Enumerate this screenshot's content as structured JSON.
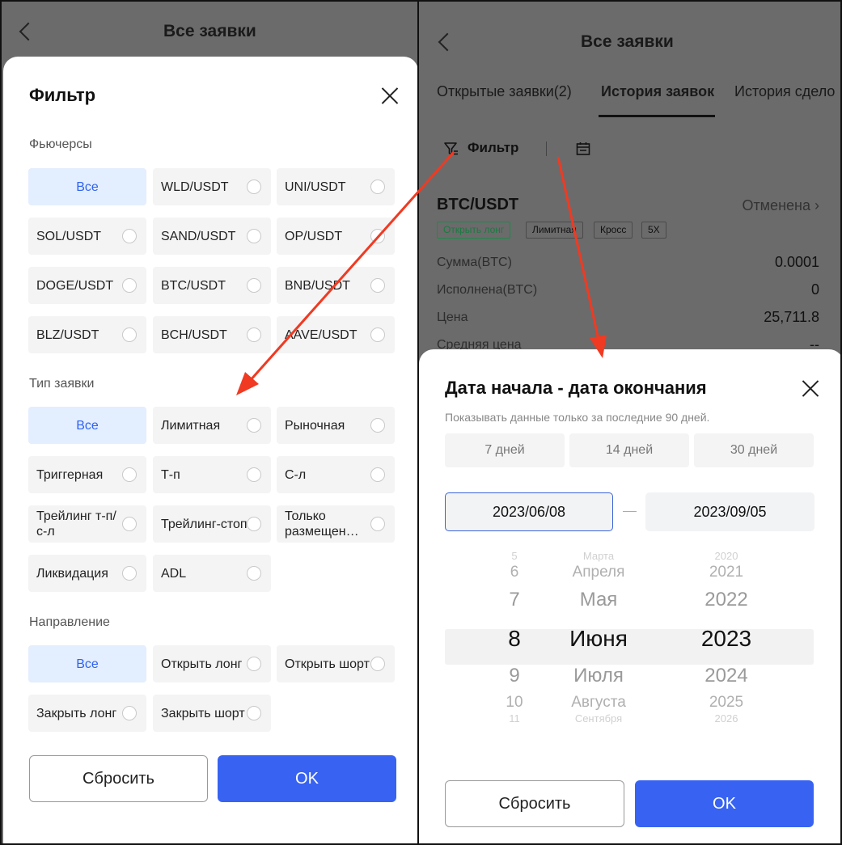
{
  "left": {
    "header": {
      "title": "Все заявки"
    },
    "filter": {
      "title": "Фильтр",
      "sections": [
        {
          "title": "Фьючерсы",
          "chips": [
            {
              "label": "Все",
              "selected": true
            },
            {
              "label": "WLD/USDT"
            },
            {
              "label": "UNI/USDT"
            },
            {
              "label": "SOL/USDT"
            },
            {
              "label": "SAND/USDT"
            },
            {
              "label": "OP/USDT"
            },
            {
              "label": "DOGE/USDT"
            },
            {
              "label": "BTC/USDT"
            },
            {
              "label": "BNB/USDT"
            },
            {
              "label": "BLZ/USDT"
            },
            {
              "label": "BCH/USDT"
            },
            {
              "label": "AAVE/USDT"
            }
          ]
        },
        {
          "title": "Тип заявки",
          "chips": [
            {
              "label": "Все",
              "selected": true
            },
            {
              "label": "Лимитная"
            },
            {
              "label": "Рыночная"
            },
            {
              "label": "Триггерная"
            },
            {
              "label": "Т-п"
            },
            {
              "label": "С-л"
            },
            {
              "label": "Трейлинг т-п/с-л"
            },
            {
              "label": "Трейлинг-стоп"
            },
            {
              "label": "Только размещен…"
            },
            {
              "label": "Ликвидация"
            },
            {
              "label": "ADL"
            }
          ]
        },
        {
          "title": "Направление",
          "chips": [
            {
              "label": "Все",
              "selected": true
            },
            {
              "label": "Открыть лонг"
            },
            {
              "label": "Открыть шорт"
            },
            {
              "label": "Закрыть лонг"
            },
            {
              "label": "Закрыть шорт"
            }
          ]
        }
      ],
      "reset_label": "Сбросить",
      "ok_label": "OK"
    }
  },
  "right": {
    "header": {
      "title": "Все заявки"
    },
    "tabs": [
      {
        "label": "Открытые заявки(2)",
        "active": false
      },
      {
        "label": "История заявок",
        "active": true
      },
      {
        "label": "История сдело",
        "active": false
      }
    ],
    "filter_label": "Фильтр",
    "order": {
      "pair": "BTC/USDT",
      "status": "Отменена",
      "tags": [
        "Открыть лонг",
        "Лимитная",
        "Кросс",
        "5X"
      ],
      "rows": [
        {
          "label": "Сумма(BTC)",
          "value": "0.0001"
        },
        {
          "label": "Исполнена(BTC)",
          "value": "0"
        },
        {
          "label": "Цена",
          "value": "25,711.8"
        },
        {
          "label": "Средняя цена",
          "value": "--"
        }
      ]
    },
    "date_sheet": {
      "title": "Дата начала - дата окончания",
      "note": "Показывать данные только за последние 90 дней.",
      "quick_ranges": [
        "7 дней",
        "14 дней",
        "30 дней"
      ],
      "start_date": "2023/06/08",
      "end_date": "2023/09/05",
      "picker": {
        "days": [
          "5",
          "6",
          "7",
          "8",
          "9",
          "10",
          "11"
        ],
        "months": [
          "Марта",
          "Апреля",
          "Мая",
          "Июня",
          "Июля",
          "Августа",
          "Сентября"
        ],
        "years": [
          "2020",
          "2021",
          "2022",
          "2023",
          "2024",
          "2025",
          "2026"
        ],
        "selected_index": 3
      },
      "reset_label": "Сбросить",
      "ok_label": "OK"
    }
  },
  "colors": {
    "accent": "#3863f2",
    "chip_selected_bg": "#e3eefe",
    "chip_selected_text": "#2e63f0",
    "annotation_arrow": "#f03a22",
    "overlay": "#6b6b6b"
  },
  "icons": [
    "back-icon",
    "close-icon",
    "funnel-icon",
    "calendar-icon",
    "chevron-right-icon",
    "radio-icon"
  ]
}
